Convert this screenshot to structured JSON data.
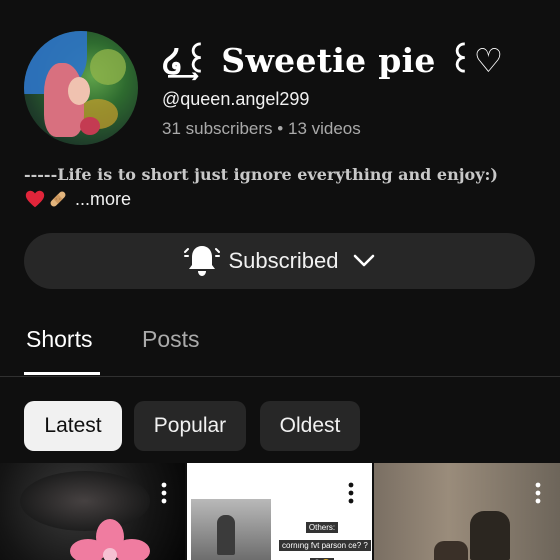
{
  "channel": {
    "name": "໒͢꒰ Sweetie pie ꒰♡",
    "handle": "@queen.angel299",
    "subscribers": "31 subscribers",
    "separator": "•",
    "videos": "13 videos",
    "description": "-----Life is to short just ignore everything and enjoy:)",
    "more_label": "...more"
  },
  "subscribe_button": {
    "label": "Subscribed"
  },
  "tabs": [
    {
      "label": "Shorts",
      "active": true
    },
    {
      "label": "Posts",
      "active": false
    }
  ],
  "filters": [
    {
      "label": "Latest",
      "selected": true
    },
    {
      "label": "Popular",
      "selected": false
    },
    {
      "label": "Oldest",
      "selected": false
    }
  ],
  "shorts": [
    {
      "caption": []
    },
    {
      "caption": [
        "Others:",
        "cornıng fvt parson ce? ?",
        "😀🤭"
      ]
    },
    {
      "caption": []
    }
  ],
  "icons": {
    "bell": "bell-icon",
    "chevron": "chevron-down-icon",
    "more": "more-vert-icon",
    "heart": "red-heart-emoji",
    "bandage": "bandage-emoji"
  },
  "colors": {
    "background": "#0f0f0f",
    "surface": "#272727",
    "text_primary": "#f1f1f1",
    "text_secondary": "#aaaaaa",
    "chip_selected_bg": "#f1f1f1"
  }
}
